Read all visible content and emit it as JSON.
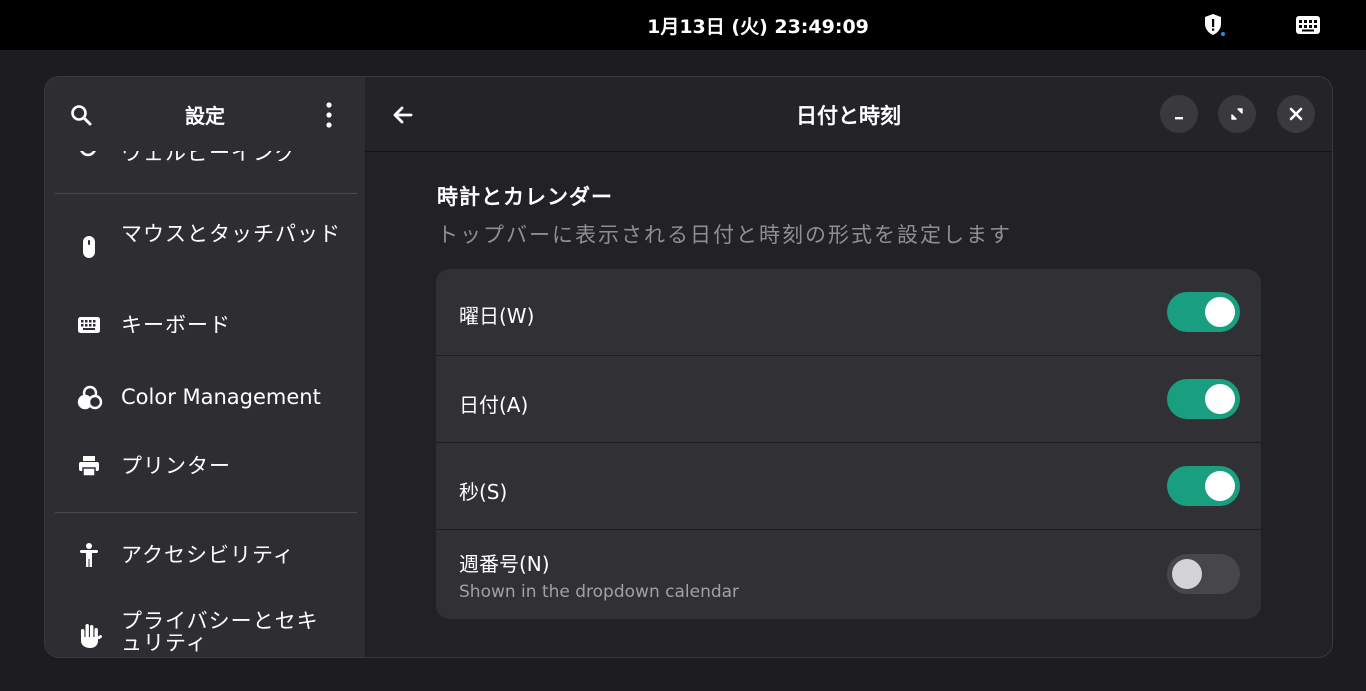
{
  "topbar": {
    "clock": "1月13日 (火)  23:49:09",
    "privacy_icon": "shield-dot-icon",
    "keyboard_icon": "keyboard-icon"
  },
  "sidebar": {
    "title": "設定",
    "search_icon": "search-icon",
    "menu_icon": "kebab-menu-icon",
    "partial_item": "ウェルビーイング",
    "items": [
      {
        "label": "マウスとタッチパッド",
        "icon": "mouse-icon"
      },
      {
        "label": "キーボード",
        "icon": "keyboard-icon"
      },
      {
        "label": "Color Management",
        "icon": "color-management-icon"
      },
      {
        "label": "プリンター",
        "icon": "printer-icon"
      },
      {
        "label": "アクセシビリティ",
        "icon": "accessibility-icon"
      },
      {
        "label": "プライバシーとセキュリティ",
        "icon": "privacy-hand-icon"
      }
    ]
  },
  "content": {
    "page_title": "日付と時刻",
    "back_icon": "back-arrow-icon",
    "section_title": "時計とカレンダー",
    "section_description": "トップバーに表示される日付と時刻の形式を設定します",
    "rows": [
      {
        "label": "曜日(W)",
        "subtitle": "",
        "enabled": true
      },
      {
        "label": "日付(A)",
        "subtitle": "",
        "enabled": true
      },
      {
        "label": "秒(S)",
        "subtitle": "",
        "enabled": true
      },
      {
        "label": "週番号(N)",
        "subtitle": "Shown in the dropdown calendar",
        "enabled": false
      }
    ]
  },
  "colors": {
    "accent": "#1a9e80",
    "sidebar_bg": "#2e2e32",
    "content_bg": "#222226",
    "card_bg": "#303035"
  }
}
